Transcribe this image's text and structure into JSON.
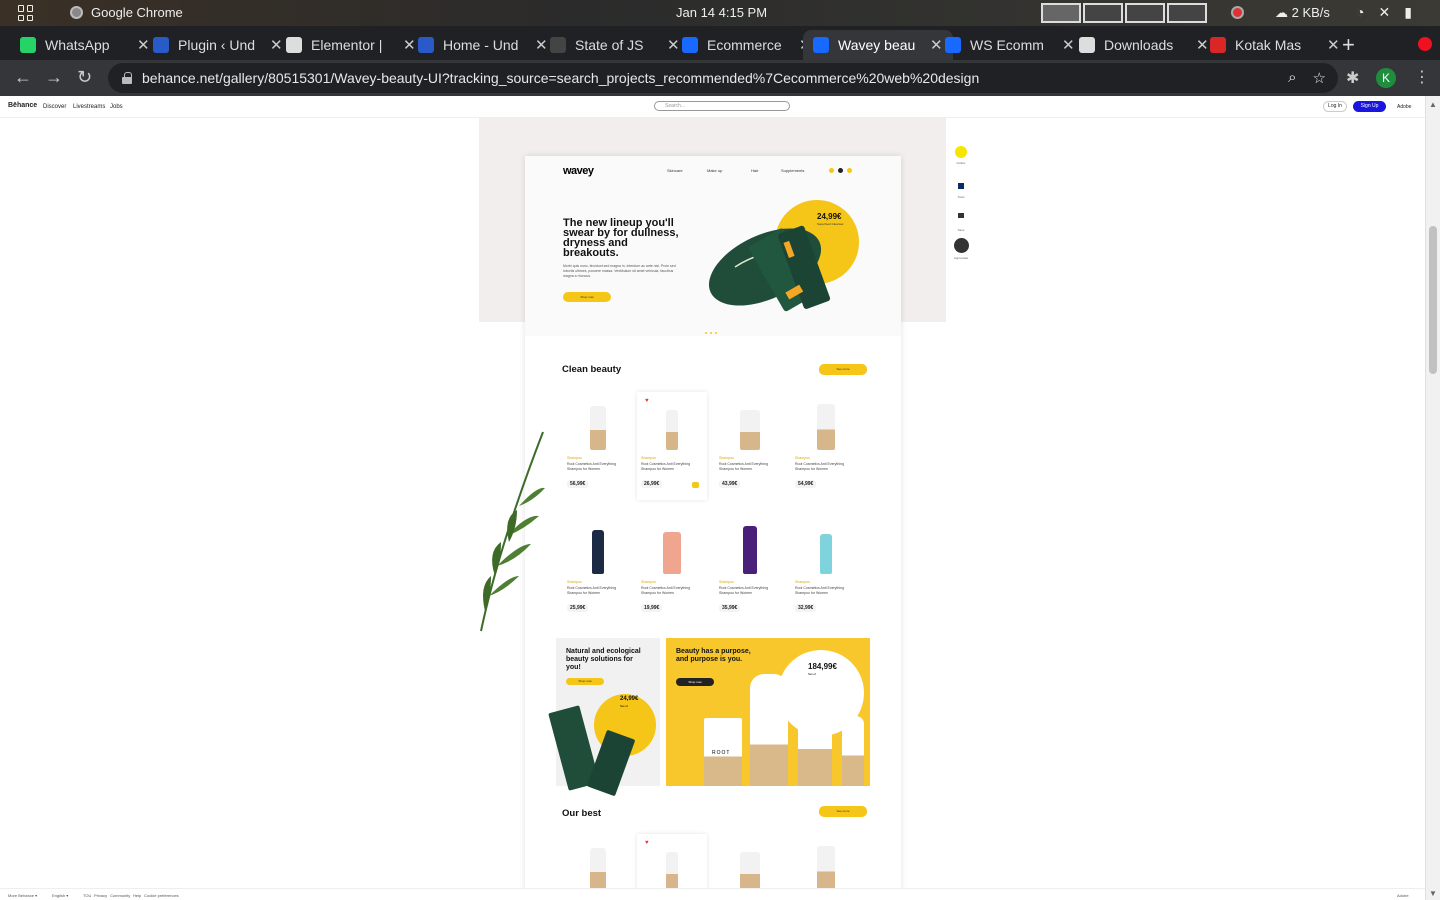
{
  "os": {
    "app_name": "Google Chrome",
    "clock": "Jan 14   4:15 PM",
    "net_speed": "2 KB/s"
  },
  "tabs": [
    {
      "label": "WhatsApp",
      "color": "#25d366",
      "icon": "whatsapp-icon"
    },
    {
      "label": "Plugin ‹ Und",
      "color": "#2a5ac8",
      "icon": "plugin-icon"
    },
    {
      "label": "Elementor |",
      "color": "#dddddd",
      "icon": "globe-icon"
    },
    {
      "label": "Home - Und",
      "color": "#2a5ac8",
      "icon": "home-icon"
    },
    {
      "label": "State of JS",
      "color": "#444444",
      "icon": "js-icon"
    },
    {
      "label": "Ecommerce",
      "color": "#1769ff",
      "icon": "behance-icon"
    },
    {
      "label": "Wavey beau",
      "color": "#1769ff",
      "icon": "behance-icon"
    },
    {
      "label": "WS Ecomm",
      "color": "#1769ff",
      "icon": "behance-icon"
    },
    {
      "label": "Downloads",
      "color": "#dddddd",
      "icon": "download-icon"
    },
    {
      "label": "Kotak Mas",
      "color": "#d92626",
      "icon": "gmail-icon"
    }
  ],
  "toolbar": {
    "url": "behance.net/gallery/80515301/Wavey-beauty-UI?tracking_source=search_projects_recommended%7Cecommerce%20web%20design",
    "profile_initial": "K"
  },
  "behance": {
    "logo": "Bēhance",
    "nav": [
      "Discover",
      "Livestreams",
      "Jobs"
    ],
    "search_placeholder": "Search...",
    "login": "Log In",
    "signup": "Sign Up",
    "adobe": "Adobe"
  },
  "side": [
    "Follow",
    "Tools",
    "Save",
    "Appreciate"
  ],
  "mock": {
    "logo": "wavey",
    "nav": [
      "Skincare",
      "Make up",
      "Hair",
      "Supplements"
    ],
    "hero_title": "The new lineup you'll swear by for dullness, dryness and breakouts.",
    "hero_desc": "Morbi quis nunc, tincidunt sed magna in, interdum ac ante nisl. Proin sed lobortis ultrices, posuere massa. Vestibulum sit amet vehicula, faucibus magna a rhoncus.",
    "hero_button": "Shop now",
    "hero_price": "24,99€",
    "hero_price_sub": "Superfood Cleanser",
    "section1": "Clean beauty",
    "section1_btn": "See more",
    "section2": "Our best",
    "section2_btn": "See more",
    "products_row1": [
      {
        "cat": "Shampoo",
        "name": "Root Cosmetics Anti Everything Shampoo for Women",
        "price": "56,99€"
      },
      {
        "cat": "Shampoo",
        "name": "Root Cosmetics Anti Everything Shampoo for Women",
        "price": "26,99€"
      },
      {
        "cat": "Shampoo",
        "name": "Root Cosmetics Anti Everything Shampoo for Women",
        "price": "43,99€"
      },
      {
        "cat": "Shampoo",
        "name": "Root Cosmetics Anti Everything Shampoo for Women",
        "price": "54,99€"
      }
    ],
    "products_row2": [
      {
        "cat": "Shampoo",
        "name": "Root Cosmetics Anti Everything Shampoo for Women",
        "price": "25,99€"
      },
      {
        "cat": "Shampoo",
        "name": "Root Cosmetics Anti Everything Shampoo for Women",
        "price": "19,99€"
      },
      {
        "cat": "Shampoo",
        "name": "Root Cosmetics Anti Everything Shampoo for Women",
        "price": "35,99€"
      },
      {
        "cat": "Shampoo",
        "name": "Root Cosmetics Anti Everything Shampoo for Women",
        "price": "32,99€"
      }
    ],
    "banner1_title": "Natural and ecological beauty solutions for you!",
    "banner1_btn": "Shop now",
    "banner1_price": "24,99€",
    "banner1_sub": "Set of",
    "banner2_title": "Beauty has a purpose, and purpose is you.",
    "banner2_btn": "Shop now",
    "banner2_price": "184,99€",
    "banner2_sub": "Set of",
    "brand": "ROOT"
  },
  "footer": [
    "More Behance ▾",
    "English ▾",
    "TOU",
    "Privacy",
    "Community",
    "Help",
    "Cookie preferences",
    "Adobe"
  ],
  "colors": {
    "accent": "#f5c518",
    "green": "#1f4d3a",
    "behance_blue": "#1a16e0"
  }
}
